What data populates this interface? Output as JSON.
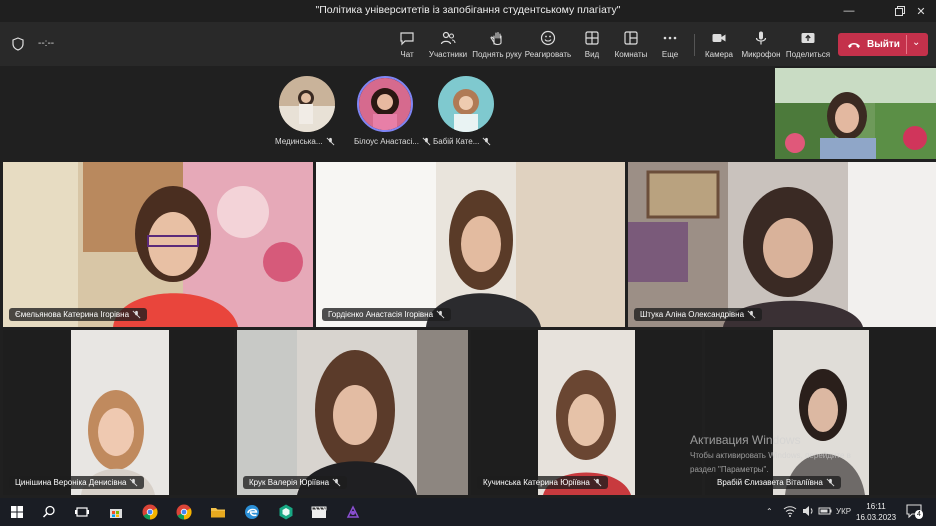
{
  "window": {
    "title": "\"Політика університетів із запобігання студентському плагіату\""
  },
  "toolbar": {
    "timer": "--:--",
    "buttons": [
      {
        "label": "Чат",
        "icon": "chat-icon"
      },
      {
        "label": "Участники",
        "icon": "participants-icon"
      },
      {
        "label": "Поднять руку",
        "icon": "raise-hand-icon"
      },
      {
        "label": "Реагировать",
        "icon": "smiley-icon"
      },
      {
        "label": "Вид",
        "icon": "grid-icon"
      },
      {
        "label": "Комнаты",
        "icon": "rooms-icon"
      },
      {
        "label": "Еще",
        "icon": "more-icon"
      },
      {
        "label": "Камера",
        "icon": "camera-icon"
      },
      {
        "label": "Микрофон",
        "icon": "microphone-icon"
      },
      {
        "label": "Поделиться",
        "icon": "share-icon"
      }
    ],
    "leave_label": "Выйти"
  },
  "participants_row": [
    {
      "name": "Мединська..."
    },
    {
      "name": "Білоус Анастасі..."
    },
    {
      "name": "Бабій Кате..."
    }
  ],
  "tiles": [
    {
      "name": "Ємельянова Катерина Ігорівна"
    },
    {
      "name": "Гордієнко Анастасія Ігорівна"
    },
    {
      "name": "Штука Аліна Олександрівна"
    },
    {
      "name": "Цинішина Вероніка Денисівна"
    },
    {
      "name": "Крук Валерія Юріївна"
    },
    {
      "name": "Кучинська Катерина Юріївна"
    },
    {
      "name": "Врабій Єлизавета Віталіївна"
    }
  ],
  "watermark": {
    "title": "Активация Windows",
    "line1": "Чтобы активировать Windows, перейдите в",
    "line2": "раздел \"Параметры\"."
  },
  "taskbar": {
    "language": "УКР",
    "time": "16:11",
    "date": "16.03.2023",
    "notifications": "4"
  },
  "colors": {
    "leave": "#c4314b",
    "accent": "#7f85f5",
    "background": "#202020"
  }
}
